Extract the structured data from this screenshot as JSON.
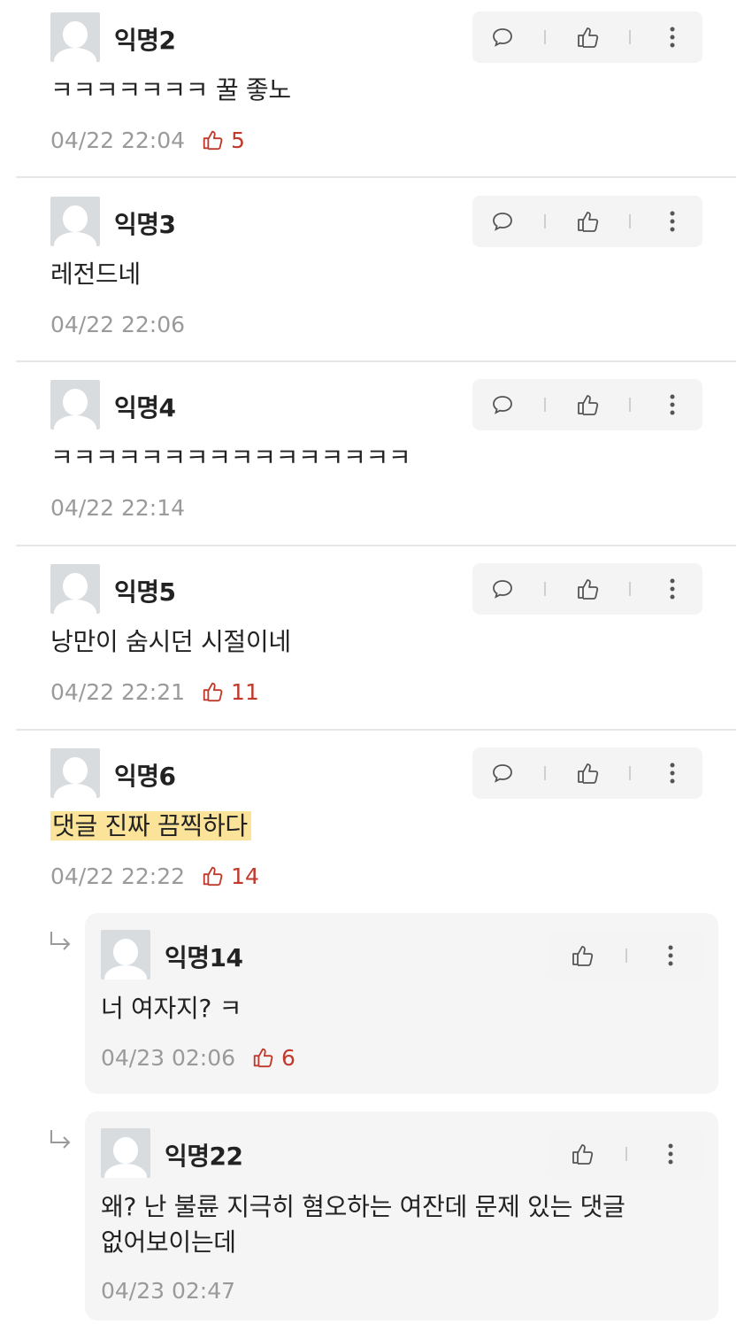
{
  "comments": [
    {
      "author": "익명2",
      "text": "ㅋㅋㅋㅋㅋㅋㅋ 꿀 좋노",
      "time": "04/22 22:04",
      "likes": "5"
    },
    {
      "author": "익명3",
      "text": "레전드네",
      "time": "04/22 22:06",
      "likes": ""
    },
    {
      "author": "익명4",
      "text": "ㅋㅋㅋㅋㅋㅋㅋㅋㅋㅋㅋㅋㅋㅋㅋㅋ",
      "time": "04/22 22:14",
      "likes": ""
    },
    {
      "author": "익명5",
      "text": "낭만이 숨시던 시절이네",
      "time": "04/22 22:21",
      "likes": "11"
    },
    {
      "author": "익명6",
      "text": "댓글 진짜 끔찍하다",
      "time": "04/22 22:22",
      "likes": "14"
    }
  ],
  "replies": [
    {
      "author": "익명14",
      "text": "너 여자지? ㅋ",
      "time": "04/23 02:06",
      "likes": "6"
    },
    {
      "author": "익명22",
      "text_line1": "왜? 난 불륜 지극히 혐오하는 여잔데 문제 있는 댓글",
      "text_line2": "없어보이는데",
      "time": "04/23 02:47"
    }
  ],
  "colors": {
    "like": "#c0392b",
    "highlight": "#fbe49a",
    "meta": "#9a9a9a"
  },
  "icons": [
    "comment-icon",
    "thumbs-up-icon",
    "more-vertical-icon",
    "reply-arrow-icon",
    "avatar-icon"
  ]
}
